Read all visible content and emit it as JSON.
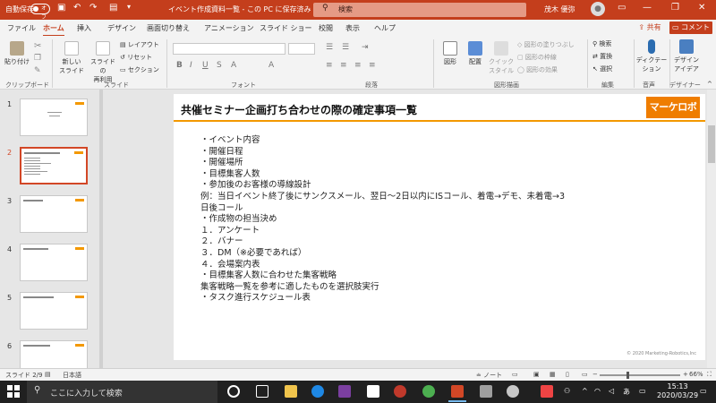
{
  "titlebar": {
    "autosave_label": "自動保存",
    "autosave_state": "オフ",
    "doc_title": "イベント作成資料一覧 - この PC に保存済み",
    "search_placeholder": "検索",
    "user_name": "茂木 優弥",
    "accent": "#c43e1c"
  },
  "tabs": [
    "ファイル",
    "ホーム",
    "挿入",
    "デザイン",
    "画面切り替え",
    "アニメーション",
    "スライド ショー",
    "校閲",
    "表示",
    "ヘルプ"
  ],
  "active_tab": "ホーム",
  "share_label": "共有",
  "comment_label": "コメント",
  "ribbon": {
    "paste": "貼り付け",
    "new_slide_1": "新しい",
    "new_slide_2": "スライド",
    "reuse_1": "スライドの",
    "reuse_2": "再利用",
    "layout": "レイアウト",
    "reset": "リセット",
    "section": "セクション",
    "shapes": "図形",
    "arrange": "配置",
    "quick_style_1": "クイック",
    "quick_style_2": "スタイル",
    "fill": "図形の塗りつぶし",
    "outline": "図形の枠線",
    "effect": "図形の効果",
    "find": "検索",
    "replace": "置換",
    "select": "選択",
    "dictate_1": "ディクテー",
    "dictate_2": "ション",
    "designer_1": "デザイン",
    "designer_2": "アイデア",
    "groups": {
      "clipboard": "クリップボード",
      "slides": "スライド",
      "font": "フォント",
      "paragraph": "段落",
      "drawing": "図形描画",
      "editing": "編集",
      "voice": "音声",
      "designer": "デザイナー"
    }
  },
  "thumbnails": [
    "1",
    "2",
    "3",
    "4",
    "5",
    "6"
  ],
  "selected_slide": "2",
  "slide": {
    "title": "共催セミナー企画打ち合わせの際の確定事項一覧",
    "brand": "マーケロボ",
    "lines": [
      "・イベント内容",
      "・開催日程",
      "・開催場所",
      "・目標集客人数",
      "・参加後のお客様の導線設計",
      "例：当日イベント終了後にサンクスメール、翌日〜2日以内にISコール、着電→デモ、未着電→3",
      "日後コール",
      "・作成物の担当決め",
      "１．アンケート",
      "２．バナー",
      "３．DM（※必要であれば）",
      "４．会場案内表",
      "・目標集客人数に合わせた集客戦略",
      "集客戦略一覧を参考に適したものを選択肢実行",
      "・タスク進行スケジュール表"
    ],
    "copyright": "© 2020 Marketing-Robotics,Inc"
  },
  "status": {
    "slide_pos": "スライド 2/9",
    "language": "日本語",
    "notes": "ノート",
    "zoom": "66%"
  },
  "taskbar": {
    "search_placeholder": "ここに入力して検索",
    "ime": "あ",
    "time": "15:13",
    "date": "2020/03/29"
  }
}
